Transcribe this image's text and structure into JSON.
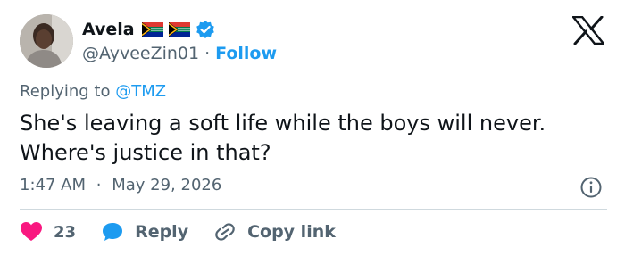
{
  "author": {
    "name": "Avela",
    "handle": "@AyveeZin01",
    "separator": "·",
    "follow_label": "Follow",
    "flags": [
      "south-africa-flag",
      "south-africa-flag"
    ],
    "verified": true
  },
  "brand_icon": "x-logo-icon",
  "reply_context": {
    "prefix": "Replying to",
    "mention": "@TMZ"
  },
  "tweet": {
    "line1": "She's leaving a soft life while the boys will never.",
    "line2": "Where's justice in that?"
  },
  "meta": {
    "time": "1:47 AM",
    "separator": "·",
    "date": "May 29, 2026"
  },
  "actions": {
    "like_count": "23",
    "reply_label": "Reply",
    "copy_link_label": "Copy link"
  },
  "colors": {
    "accent": "#1d9bf0",
    "like": "#f91880",
    "text": "#0f1419",
    "muted": "#536471",
    "divider": "#cfd9de"
  }
}
